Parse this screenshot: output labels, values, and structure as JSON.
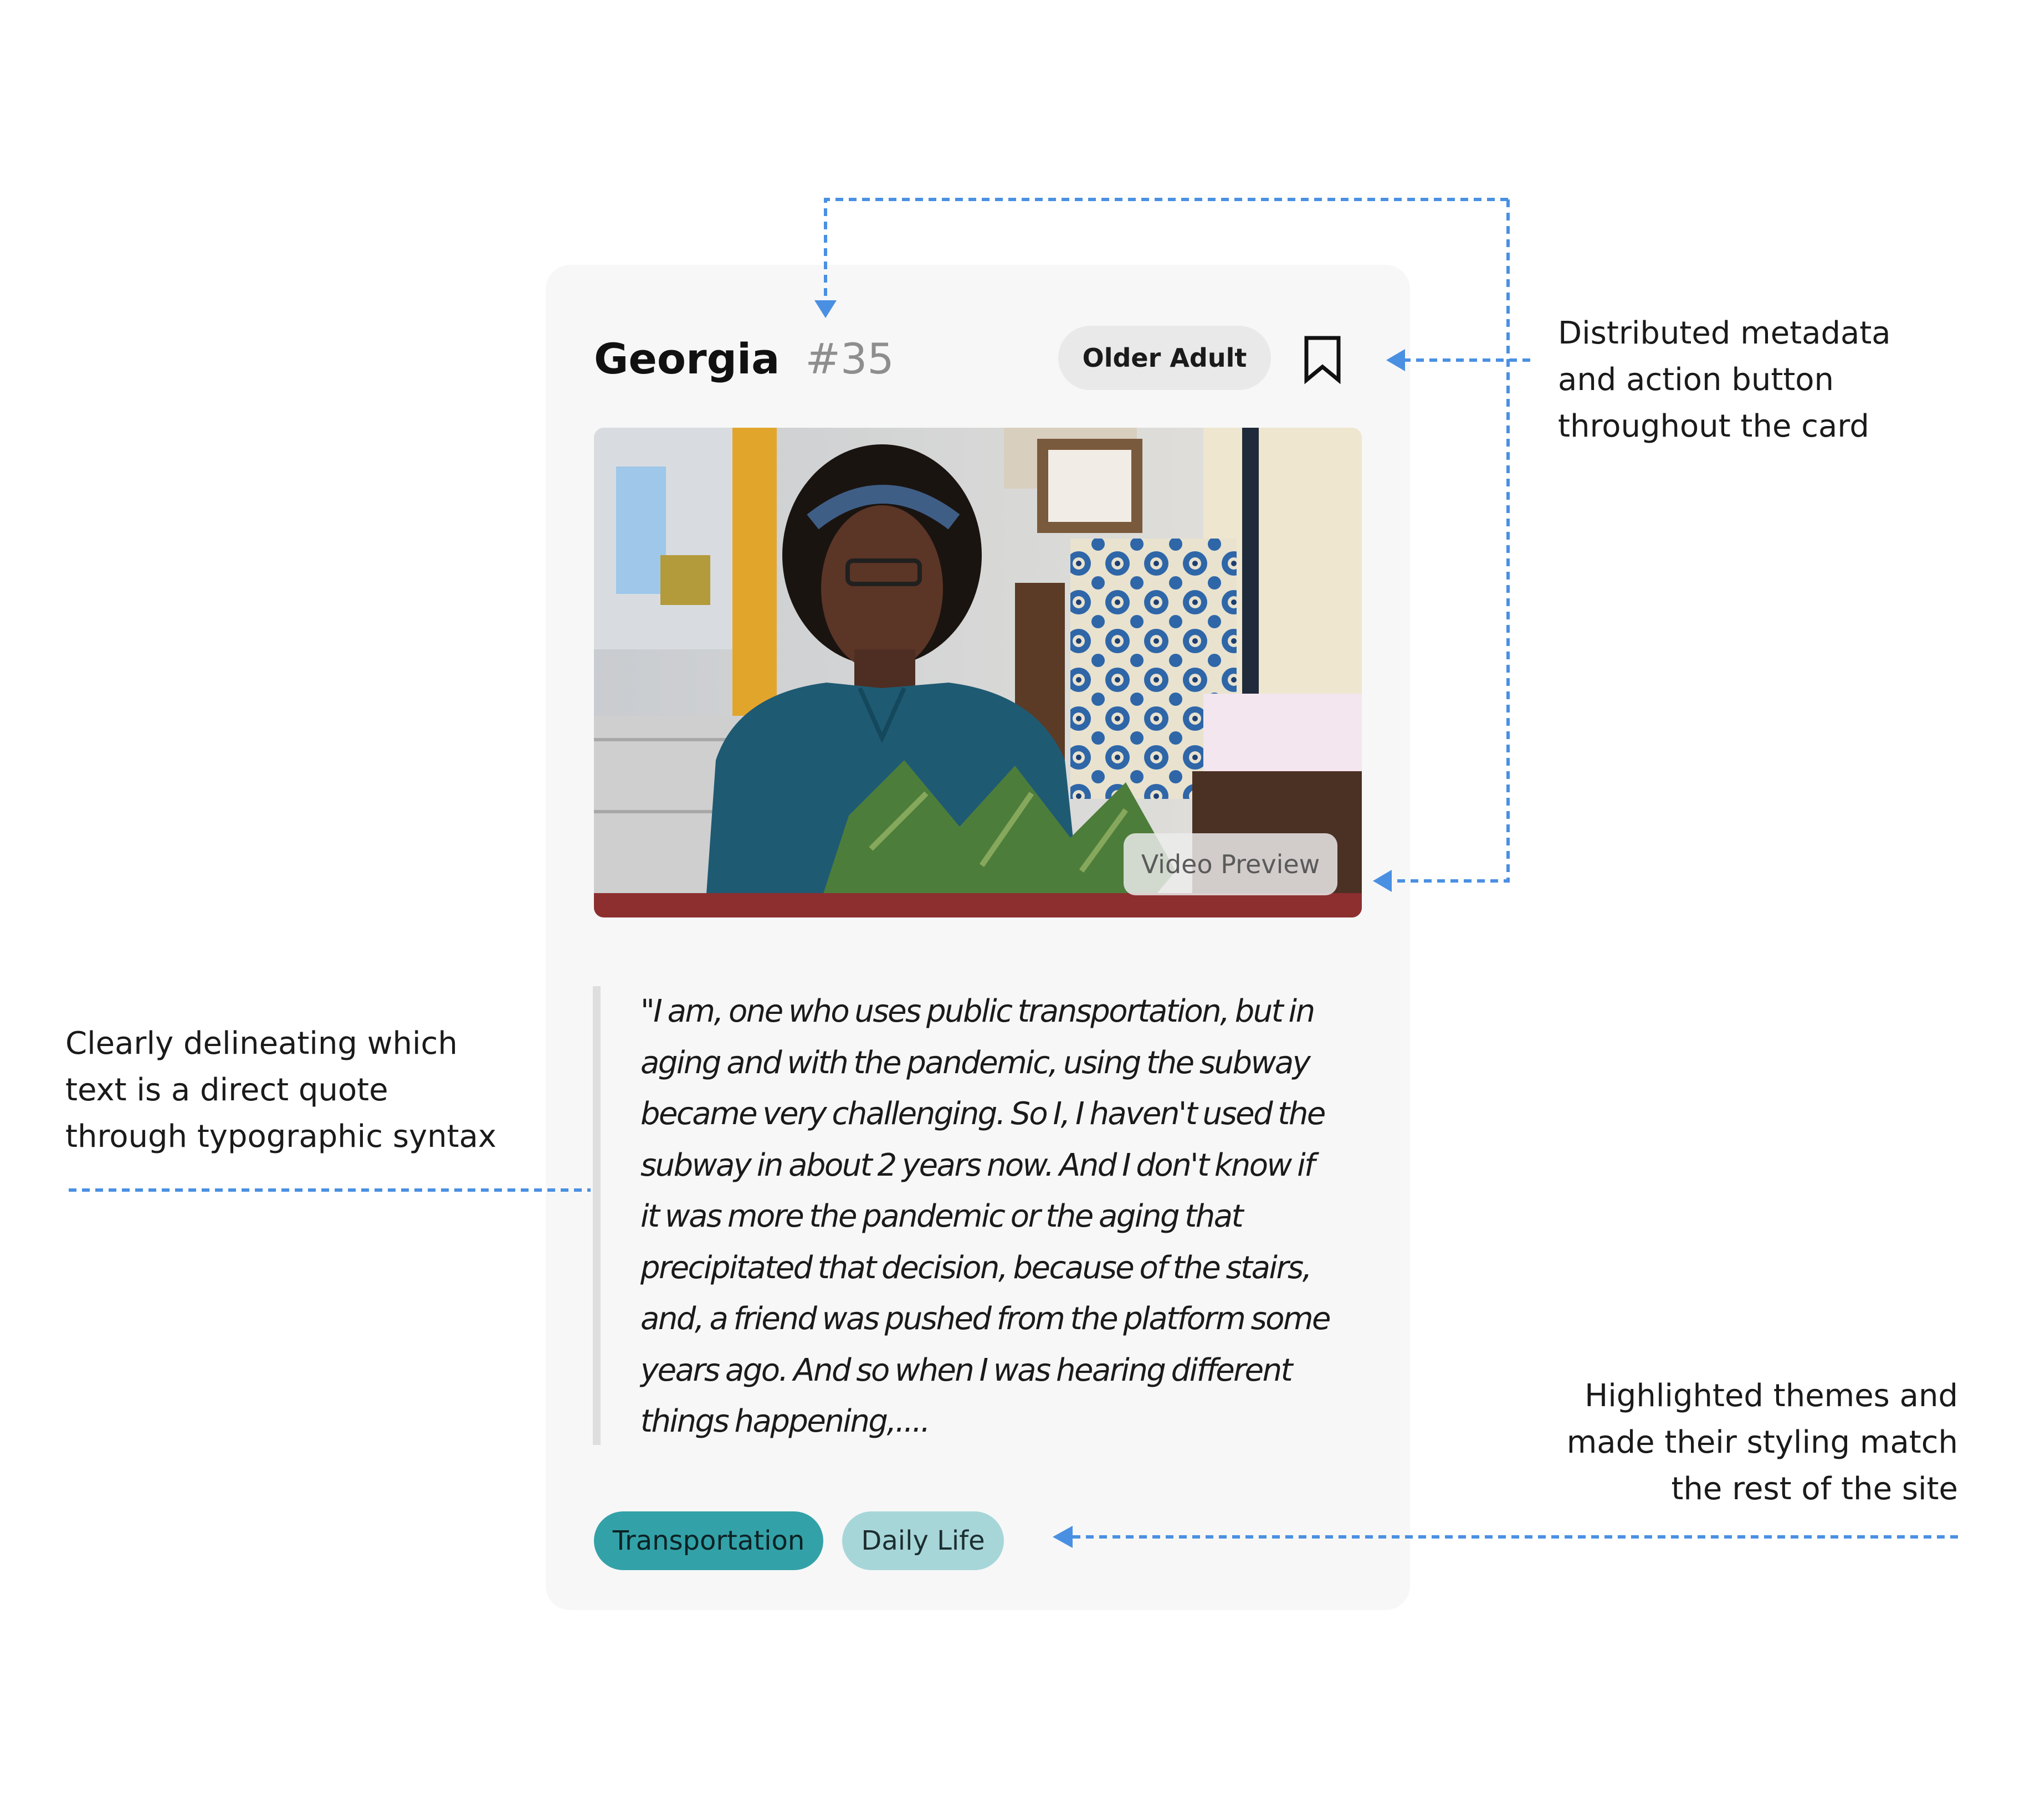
{
  "card": {
    "name": "Georgia",
    "number": "#35",
    "badge": "Older Adult",
    "bookmark_icon": "bookmark-icon",
    "video_preview_label": "Video Preview",
    "photo_description": "photo",
    "quote_lines": [
      "\"I am, one who uses public transportation, but in",
      "aging and with the pandemic, using the subway",
      "became very challenging. So I, I haven't used the",
      "subway in about 2 years now. And I don't know if",
      "it was more the pandemic or the aging that",
      "precipitated that decision, because of the stairs,",
      "and, a friend was pushed from the platform some",
      "years ago. And so when I was hearing different",
      "things happening,...."
    ],
    "tags": [
      "Transportation",
      "Daily Life"
    ]
  },
  "annotations": {
    "metadata_note": [
      "Distributed metadata",
      "and action button",
      "throughout the card"
    ],
    "quote_note": [
      "Clearly delineating which",
      "text is a direct quote",
      "through typographic syntax"
    ],
    "themes_note": [
      "Highlighted themes and",
      "made their styling match",
      "the rest of the site"
    ]
  },
  "colors": {
    "accent_teal": "#33a1a8",
    "light_teal": "#a7d6d9",
    "annotation_blue": "#4a90e2",
    "card_background": "#f7f7f7"
  }
}
